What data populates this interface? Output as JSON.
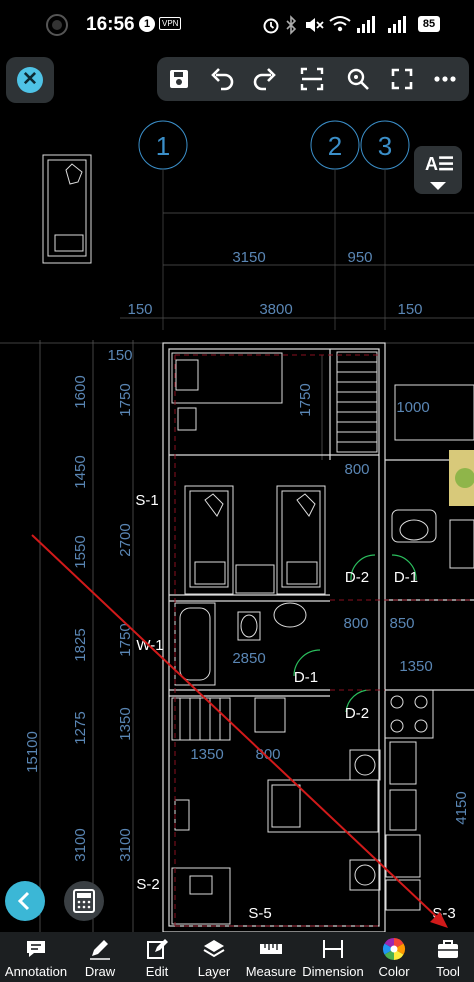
{
  "status": {
    "time": "16:56",
    "notif_count": "1",
    "vpn": "VPN",
    "battery": "85"
  },
  "grid": {
    "bubble1": "1",
    "bubble2": "2",
    "bubble3": "3"
  },
  "font_button": {
    "label": "A☰"
  },
  "dims": {
    "d3150": "3150",
    "d950": "950",
    "d150a": "150",
    "d3800": "3800",
    "d150b": "150",
    "d150c": "150",
    "d1600": "1600",
    "d1750a": "1750",
    "d1750b": "1750",
    "d1000": "1000",
    "d1450": "1450",
    "d800a": "800",
    "d2700": "2700",
    "d1550": "1550",
    "d1750c": "1750",
    "d800b": "800",
    "d850": "850",
    "d1825": "1825",
    "d2850": "2850",
    "d1350a": "1350",
    "d1275": "1275",
    "d1350b": "1350",
    "d1350c": "1350",
    "d800c": "800",
    "d15100": "15100",
    "d4150": "4150",
    "d3100a": "3100",
    "d3100b": "3100"
  },
  "labels": {
    "s1": "S-1",
    "d2a": "D-2",
    "d1a": "D-1",
    "w1": "W-1",
    "d1b": "D-1",
    "d2b": "D-2",
    "s2": "S-2",
    "s5": "S-5",
    "s3": "S-3"
  },
  "bottom_tools": [
    {
      "label": "Annotation",
      "icon": "annotation-icon"
    },
    {
      "label": "Draw",
      "icon": "pencil-icon"
    },
    {
      "label": "Edit",
      "icon": "edit-icon"
    },
    {
      "label": "Layer",
      "icon": "layers-icon"
    },
    {
      "label": "Measure",
      "icon": "ruler-icon"
    },
    {
      "label": "Dimension",
      "icon": "dimension-icon"
    },
    {
      "label": "Color",
      "icon": "color-wheel-icon"
    },
    {
      "label": "Tool",
      "icon": "toolbox-icon"
    }
  ],
  "colors": {
    "accent": "#3bb7d6",
    "cad_dim": "#5a86b4",
    "cad_grid": "#3b8fc9",
    "arrow": "#d11a1a",
    "bar": "#1c1f21"
  }
}
